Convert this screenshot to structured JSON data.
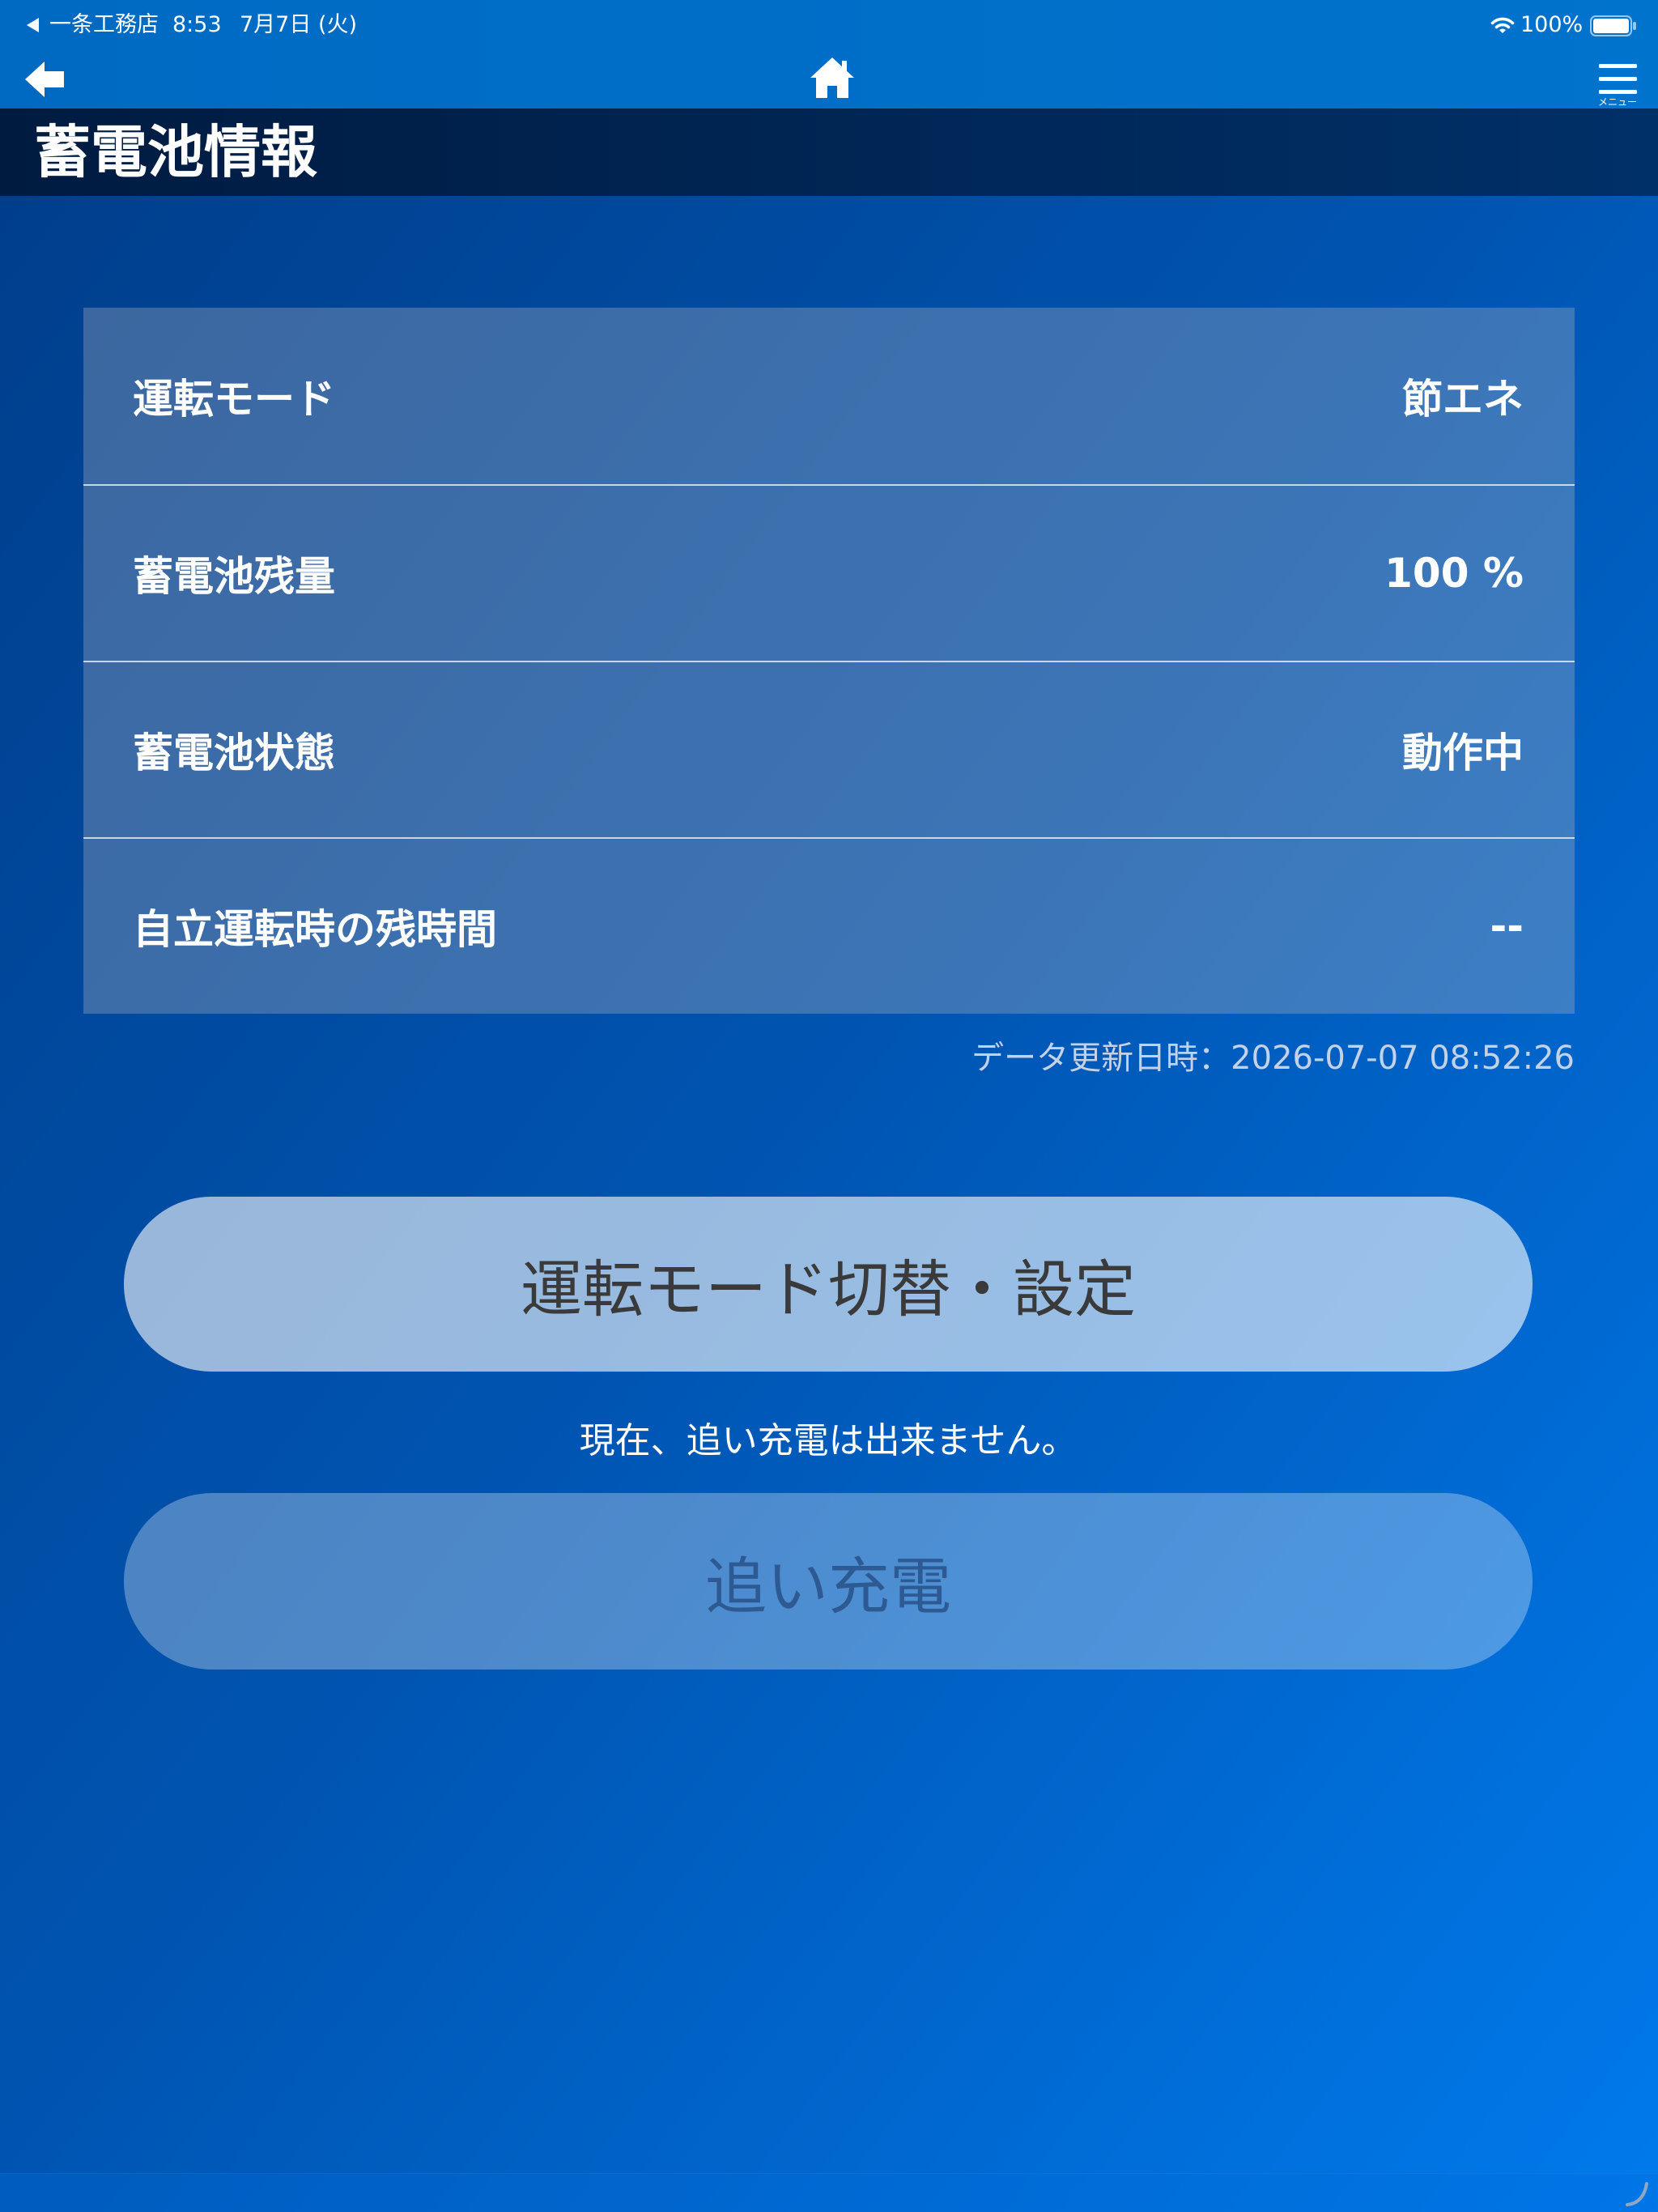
{
  "status_bar": {
    "back_app": "一条工務店",
    "time": "8:53",
    "date": "7月7日 (火)",
    "battery_percent": "100%",
    "battery_level": 1
  },
  "nav": {
    "back_icon": "back-arrow-icon",
    "home_icon": "home-icon",
    "menu_icon": "menu-icon",
    "menu_label": "メニュー"
  },
  "page": {
    "title": "蓄電池情報"
  },
  "battery_info": {
    "rows": [
      {
        "label": "運転モード",
        "value": "節エネ"
      },
      {
        "label": "蓄電池残量",
        "value": "100 %"
      },
      {
        "label": "蓄電池状態",
        "value": "動作中"
      },
      {
        "label": "自立運転時の残時間",
        "value": "--"
      }
    ],
    "updated_at": "データ更新日時：2026-07-07 08:52:26"
  },
  "actions": {
    "mode_settings_label": "運転モード切替・設定",
    "extra_charge_notice": "現在、追い充電は出来ません。",
    "extra_charge_label": "追い充電",
    "extra_charge_enabled": false
  },
  "colors": {
    "header_bg_left": "#006ac2",
    "header_bg_right": "#0073cd",
    "title_bar_left": "#001b40",
    "title_bar_right": "#003068",
    "background_start": "#003c88",
    "background_mid": "#0055b2",
    "background_end": "#007aec",
    "primary_button_text": "#3a3a3a",
    "disabled_button_text": "#2d5a92",
    "timestamp_text": "#c3d2e6"
  }
}
